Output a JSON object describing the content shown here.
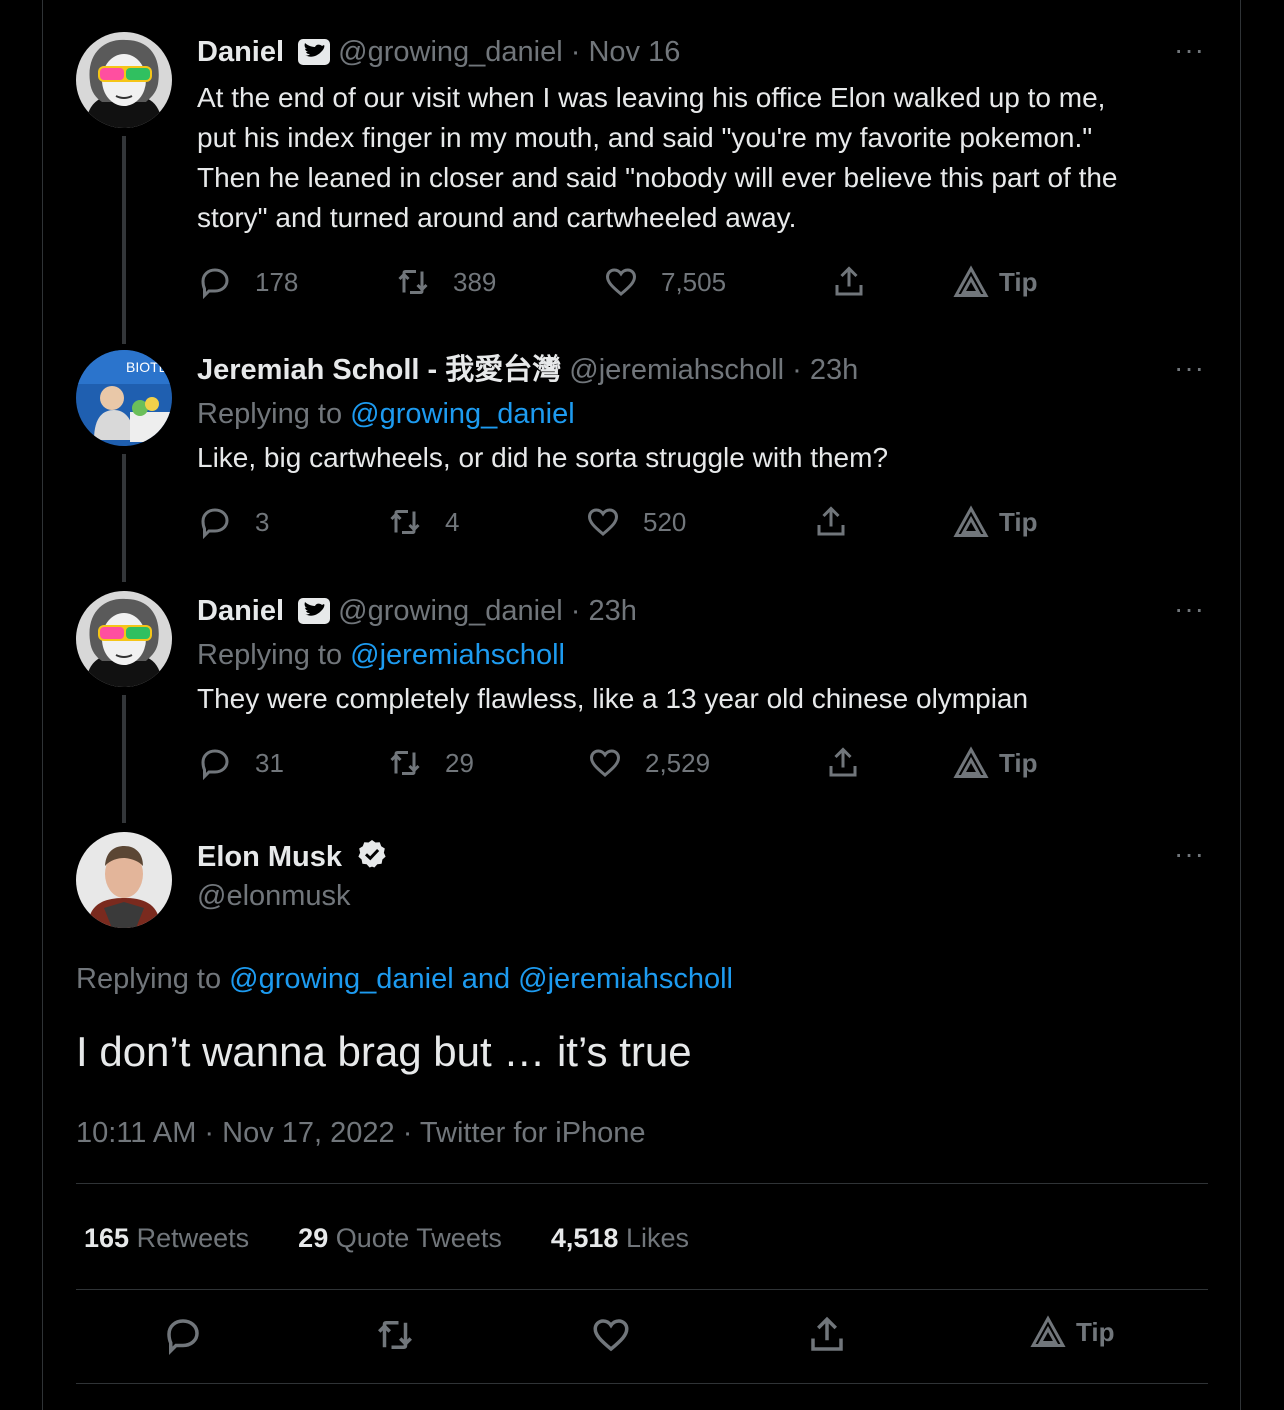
{
  "thread": [
    {
      "name": "Daniel",
      "handle": "@growing_daniel",
      "time": "· Nov 16",
      "replying_prefix": "",
      "replying_to": "",
      "text_lines": [
        "At the end of our visit when I was leaving his office Elon walked up to me,",
        "put his index finger in my mouth, and said \"you're my favorite pokemon.\"",
        "Then he leaned in closer and said \"nobody will ever believe this part of the",
        "story\" and turned around and cartwheeled away."
      ],
      "replies": "178",
      "retweets": "389",
      "likes": "7,505",
      "tip": "Tip"
    },
    {
      "name": "Jeremiah Scholl - 我愛台灣",
      "handle": "@jeremiahscholl",
      "time": "· 23h",
      "replying_prefix": "Replying to",
      "replying_to": "@growing_daniel",
      "text_lines": [
        "Like, big cartwheels, or did he sorta struggle with them?"
      ],
      "replies": "3",
      "retweets": "4",
      "likes": "520",
      "tip": "Tip"
    },
    {
      "name": "Daniel",
      "handle": "@growing_daniel",
      "time": "· 23h",
      "replying_prefix": "Replying to",
      "replying_to": "@jeremiahscholl",
      "text_lines": [
        "They were completely flawless, like a 13 year old chinese olympian"
      ],
      "replies": "31",
      "retweets": "29",
      "likes": "2,529",
      "tip": "Tip"
    }
  ],
  "main": {
    "name": "Elon Musk",
    "handle": "@elonmusk",
    "replying_prefix": "Replying to",
    "replying_to": "@growing_daniel and @jeremiahscholl",
    "text": "I don’t wanna brag but … it’s true",
    "meta": "10:11 AM · Nov 17, 2022 · Twitter for iPhone",
    "stats": {
      "retweets_count": "165",
      "retweets_label": "Retweets",
      "quotes_count": "29",
      "quotes_label": "Quote Tweets",
      "likes_count": "4,518",
      "likes_label": "Likes"
    },
    "tip": "Tip"
  },
  "more_label": "···",
  "colors": {
    "accent": "#1d9bf0",
    "muted": "#71767b",
    "text": "#e7e9ea",
    "divider": "#2f3336"
  },
  "icons": [
    "reply-icon",
    "retweet-icon",
    "like-icon",
    "share-icon",
    "tip-icon",
    "more-icon",
    "verified-badge-icon",
    "bot-label-icon"
  ]
}
